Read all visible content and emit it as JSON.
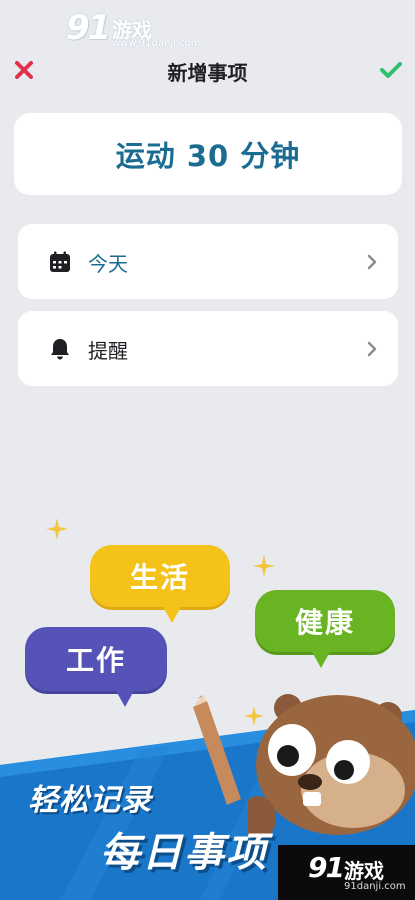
{
  "watermark_top": {
    "num": "91",
    "name": "游戏",
    "url": "www.91danji.com"
  },
  "header": {
    "title": "新增事项"
  },
  "task": {
    "title": "运动 30 分钟"
  },
  "rows": [
    {
      "label": "今天",
      "color": "#1a6d91"
    },
    {
      "label": "提醒",
      "color": "#1f1f24"
    }
  ],
  "promo": {
    "bubbles": {
      "life": "生活",
      "health": "健康",
      "work": "工作"
    },
    "slogan_line1": "轻松记录",
    "slogan_line2": "每日事项"
  },
  "watermark_bottom": {
    "num": "91",
    "name": "游戏",
    "url": "91danji.com"
  },
  "colors": {
    "close": "#e0314b",
    "confirm": "#2fbf71",
    "accent": "#1a6d91",
    "banner": "#1976c9"
  }
}
